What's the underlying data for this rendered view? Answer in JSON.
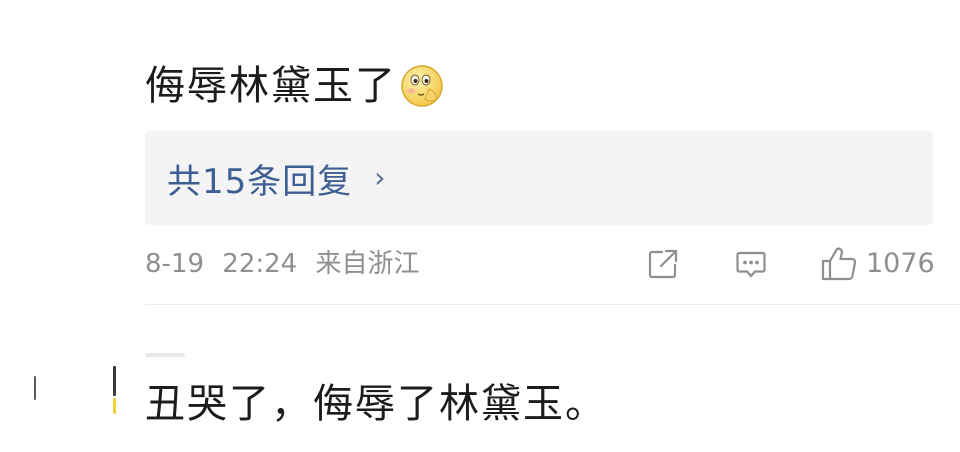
{
  "comment": {
    "text": "侮辱林黛玉了",
    "emoji": "blush-face-emoji"
  },
  "replies": {
    "label": "共15条回复",
    "chevron": "›"
  },
  "meta": {
    "date": "8-19",
    "time": "22:24",
    "location": "来自浙江"
  },
  "actions": {
    "share_icon": "share-icon",
    "comment_icon": "comment-icon",
    "like_icon": "thumbs-up-icon",
    "like_count": "1076"
  },
  "next_comment": {
    "text": "丑哭了，侮辱了林黛玉。"
  },
  "colors": {
    "reply_link": "#3e5f93",
    "meta_gray": "#8f8f8f",
    "reply_box_bg": "#f4f4f4"
  }
}
